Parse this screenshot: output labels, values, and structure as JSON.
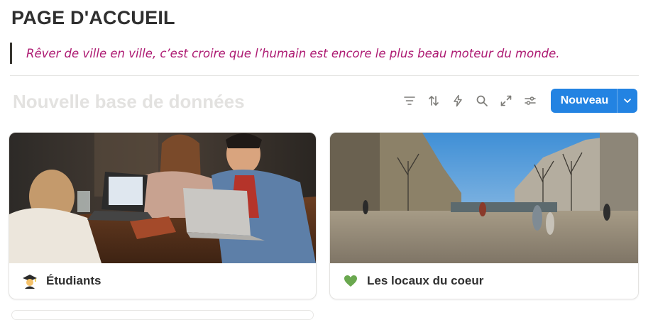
{
  "page": {
    "title": "PAGE D'ACCUEIL",
    "quote": "Rêver de ville en ville, c’est croire que l’humain est encore le plus beau moteur du monde."
  },
  "database": {
    "title": "Nouvelle base de données",
    "toolbar": {
      "icons": [
        "filter-icon",
        "sort-icon",
        "automation-icon",
        "search-icon",
        "expand-icon",
        "settings-icon"
      ],
      "new_label": "Nouveau"
    },
    "cards": [
      {
        "emoji_icon": "student-icon",
        "label": "Étudiants",
        "cover": "students-laptop-photo"
      },
      {
        "emoji_icon": "green-heart-icon",
        "label": "Les locaux du coeur",
        "cover": "city-square-photo"
      }
    ]
  },
  "colors": {
    "accent": "#2383e2",
    "quote": "#ad1a72",
    "muted_title": "#e3e2e0",
    "icon": "#7d7c78"
  }
}
